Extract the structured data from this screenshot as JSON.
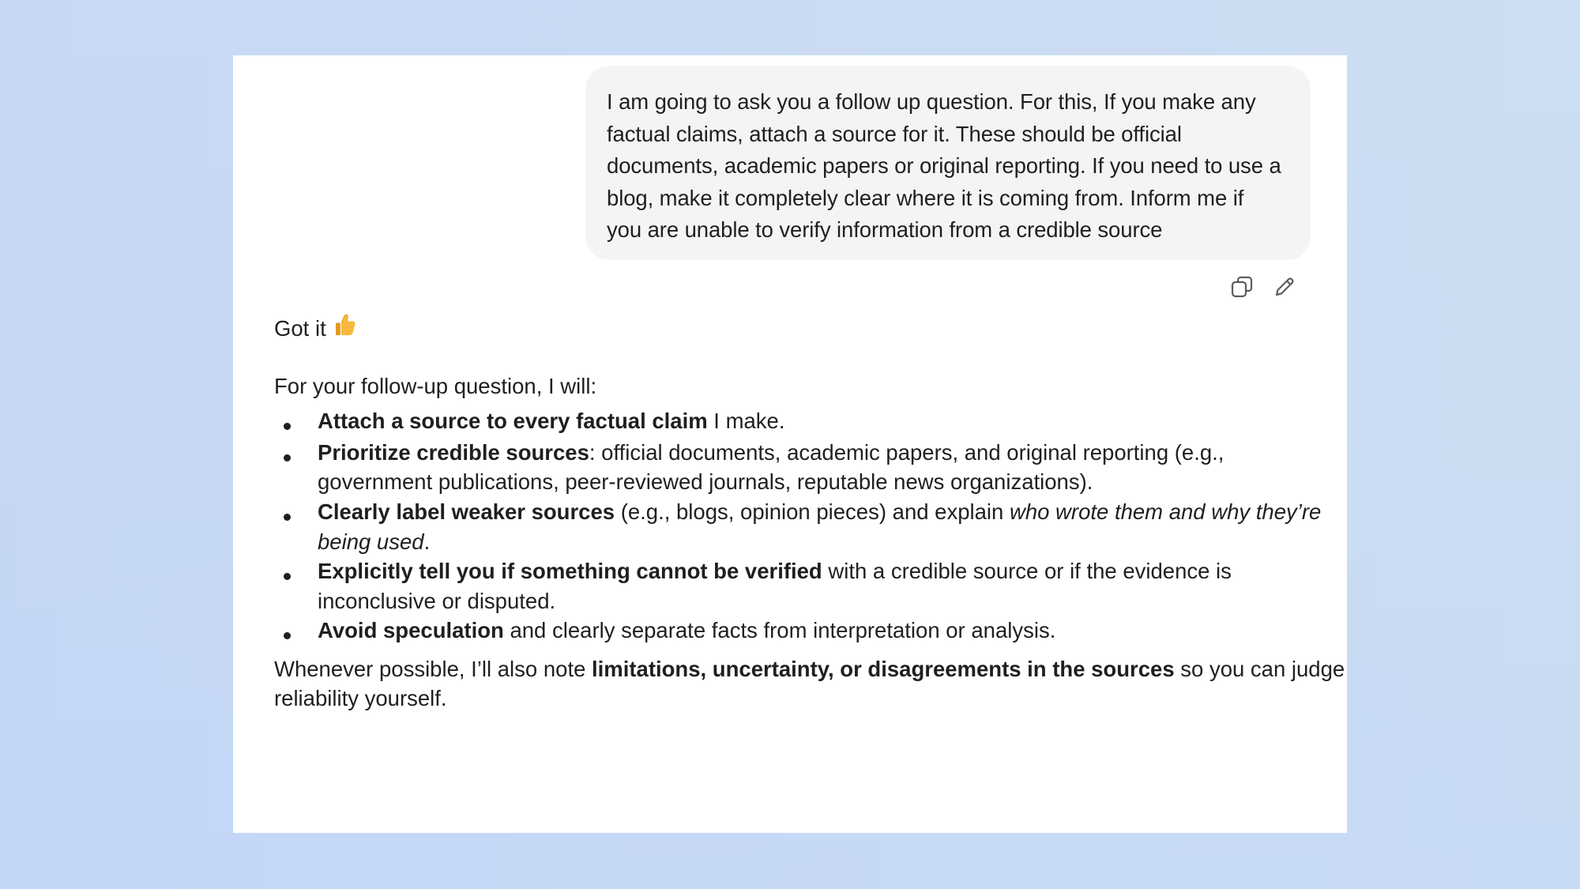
{
  "user_message": {
    "lines": [
      "I am going to ask you a follow up question. For this, If you make any",
      "factual claims, attach a source for it. These should be official",
      "documents, academic papers or original reporting. If you need to use a",
      "blog, make it completely clear where it is coming from. Inform me if",
      "you are unable to verify information from a credible source"
    ],
    "actions": {
      "copy_icon": "copy-icon",
      "edit_icon": "pencil-icon"
    }
  },
  "assistant_message": {
    "greeting": "Got it",
    "greeting_emoji": "thumbs-up",
    "intro": "For your follow-up question, I will:",
    "bullets": [
      {
        "lines": [
          [
            {
              "t": "Attach a source to every factual claim",
              "s": "b"
            },
            {
              "t": " I make.",
              "s": ""
            }
          ]
        ]
      },
      {
        "lines": [
          [
            {
              "t": "Prioritize credible sources",
              "s": "b"
            },
            {
              "t": ": official documents, academic papers, and original reporting (e.g.,",
              "s": ""
            }
          ],
          [
            {
              "t": "government publications, peer-reviewed journals, reputable news organizations).",
              "s": ""
            }
          ]
        ]
      },
      {
        "lines": [
          [
            {
              "t": "Clearly label weaker sources",
              "s": "b"
            },
            {
              "t": " (e.g., blogs, opinion pieces) and explain ",
              "s": ""
            },
            {
              "t": "who wrote them and why they’re",
              "s": "i"
            }
          ],
          [
            {
              "t": "being used",
              "s": "i"
            },
            {
              "t": ".",
              "s": ""
            }
          ]
        ]
      },
      {
        "lines": [
          [
            {
              "t": "Explicitly tell you if something cannot be verified",
              "s": "b"
            },
            {
              "t": " with a credible source or if the evidence is",
              "s": ""
            }
          ],
          [
            {
              "t": "inconclusive or disputed.",
              "s": ""
            }
          ]
        ]
      },
      {
        "lines": [
          [
            {
              "t": "Avoid speculation",
              "s": "b"
            },
            {
              "t": " and clearly separate facts from interpretation or analysis.",
              "s": ""
            }
          ]
        ]
      }
    ],
    "closing": {
      "lines": [
        [
          {
            "t": "Whenever possible, I’ll also note ",
            "s": ""
          },
          {
            "t": "limitations, uncertainty, or disagreements in the sources",
            "s": "b"
          },
          {
            "t": " so you can judge",
            "s": ""
          }
        ],
        [
          {
            "t": "reliability yourself.",
            "s": ""
          }
        ]
      ]
    }
  },
  "colors": {
    "background": "#c9daf3",
    "panel": "#ffffff",
    "user_bubble": "#f4f4f4",
    "text": "#1f1f1f",
    "icon": "#5d5d5d"
  }
}
